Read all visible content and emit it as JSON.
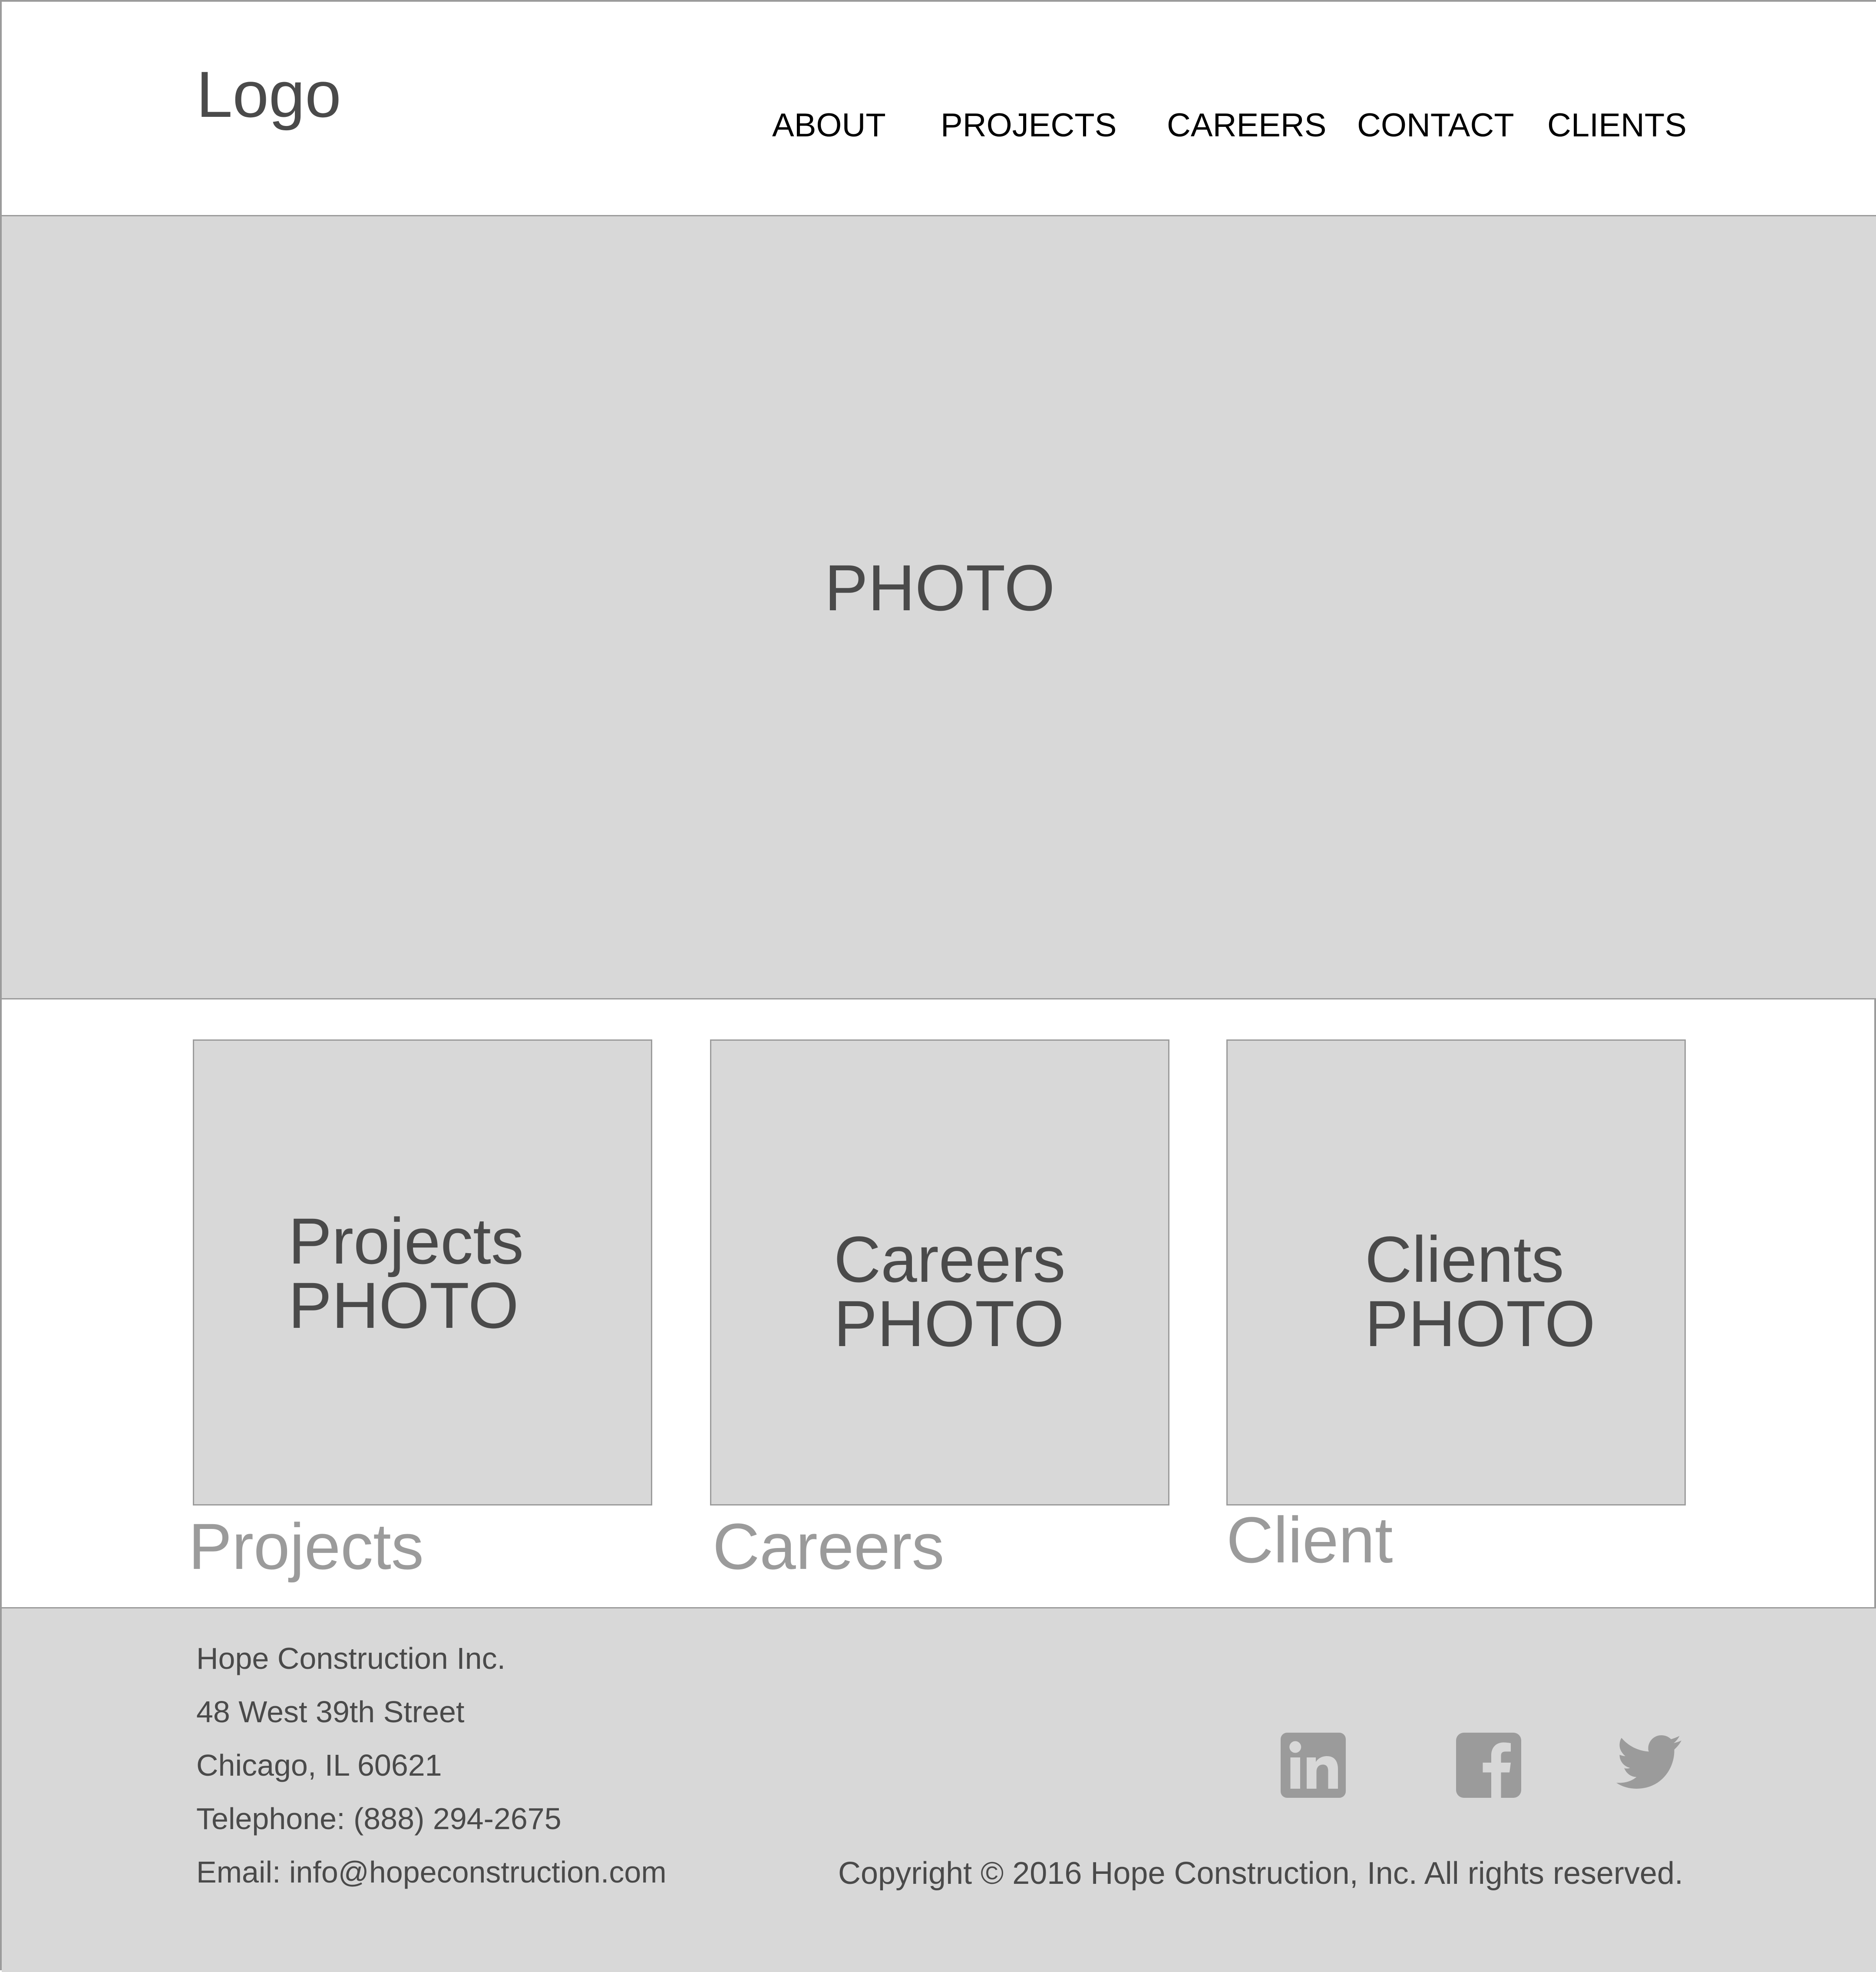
{
  "header": {
    "logo": "Logo",
    "nav": [
      "ABOUT",
      "PROJECTS",
      "CAREERS",
      "CONTACT",
      "CLIENTS"
    ]
  },
  "hero": {
    "label": "PHOTO"
  },
  "cards": [
    {
      "title": "Projects",
      "photo_label": "PHOTO",
      "caption": "Projects"
    },
    {
      "title": "Careers",
      "photo_label": "PHOTO",
      "caption": "Careers"
    },
    {
      "title": "Clients",
      "photo_label": "PHOTO",
      "caption": "Client"
    }
  ],
  "footer": {
    "company": "Hope Construction Inc.",
    "street": "48 West 39th Street",
    "city": "Chicago, IL 60621",
    "telephone": "Telephone: (888) 294-2675",
    "email": "Email: info@hopeconstruction.com",
    "copyright": "Copyright © 2016 Hope Construction, Inc. All rights reserved.",
    "social": [
      "linkedin-icon",
      "facebook-icon",
      "twitter-icon"
    ]
  },
  "colors": {
    "placeholder_fill": "#d8d8d8",
    "border": "#9b9b9b",
    "text_dark": "#4a4a4a",
    "text_muted": "#9b9b9b",
    "nav_text": "#000000"
  }
}
